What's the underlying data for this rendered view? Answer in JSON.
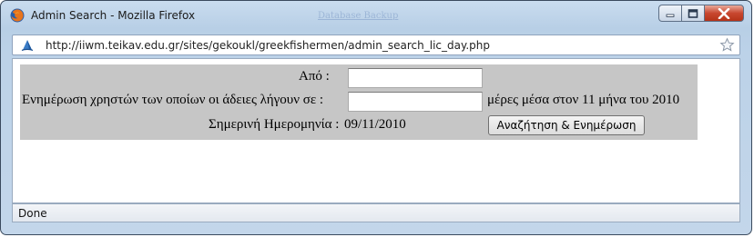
{
  "window": {
    "title": "Admin Search - Mozilla Firefox",
    "ghost_tab_text": "Database Backup",
    "controls": [
      "minimize",
      "maximize",
      "close"
    ]
  },
  "addressbar": {
    "url": "http://iiwm.teikav.edu.gr/sites/gekoukl/greekfishermen/admin_search_lic_day.php"
  },
  "form": {
    "from_label": "Από :",
    "from_value": "",
    "update_label": "Ενημέρωση χρηστών των οποίων οι άδειες λήγουν σε :",
    "days_value": "",
    "days_suffix": "μέρες μέσα στον 11 μήνα του 2010",
    "date_label": "Σημερινή Ημερομηνία :",
    "date_value": "09/11/2010",
    "submit_label": "Αναζήτηση & Ενημέρωση",
    "panel_color": "#c6c6c6"
  },
  "status": {
    "text": "Done"
  },
  "icons": {
    "browser": "firefox-icon",
    "site": "site-favicon",
    "bookmark": "star-icon"
  }
}
